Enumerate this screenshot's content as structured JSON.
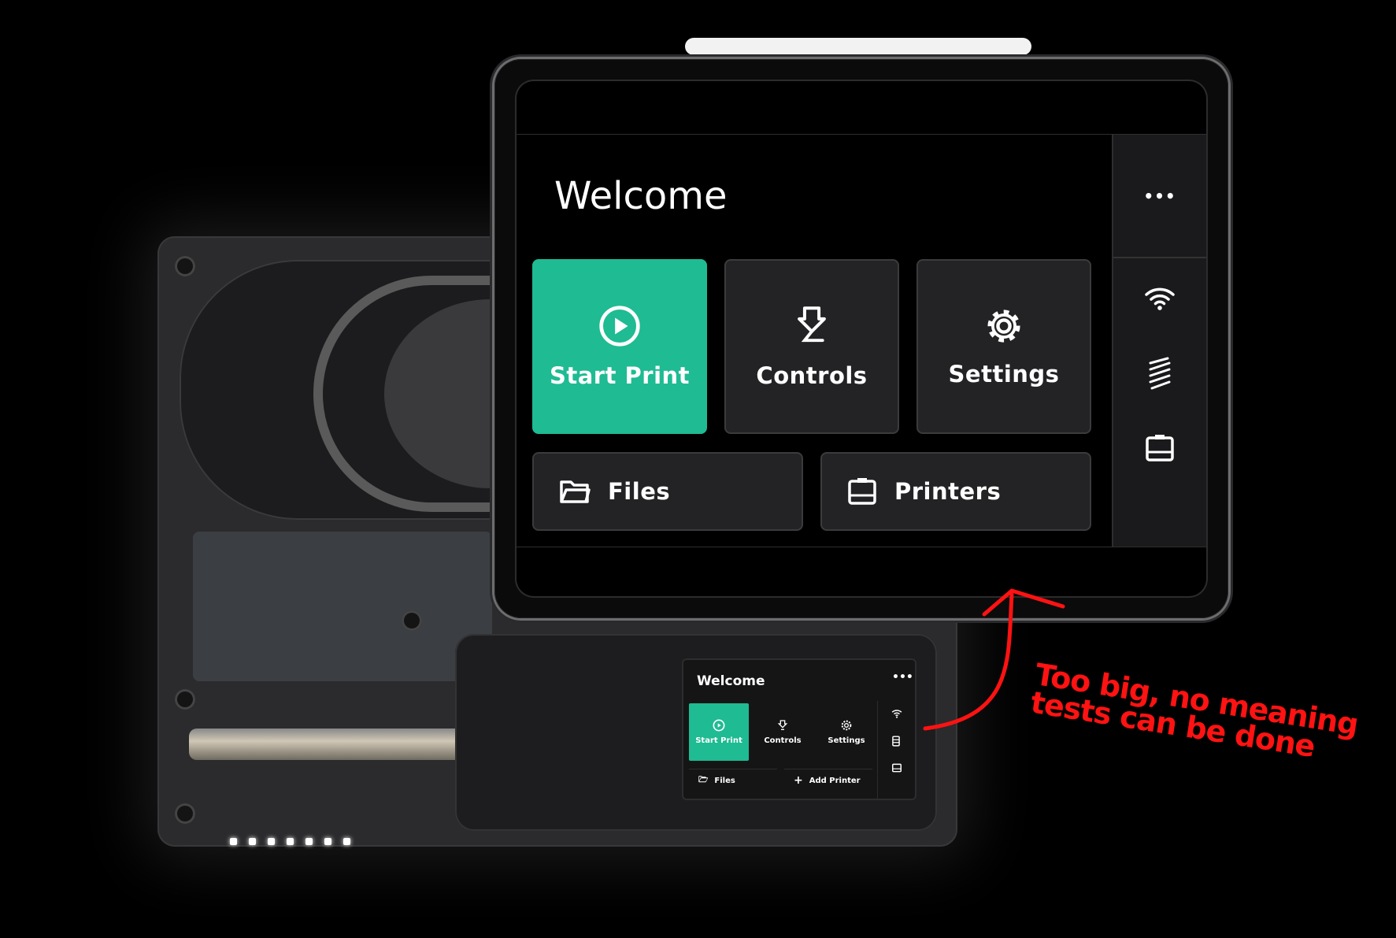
{
  "main_screen": {
    "title": "Welcome",
    "tiles": [
      {
        "label": "Start Print",
        "icon": "play-circle-icon",
        "primary": true
      },
      {
        "label": "Controls",
        "icon": "extruder-icon"
      },
      {
        "label": "Settings",
        "icon": "gear-icon"
      }
    ],
    "wide_tiles": [
      {
        "label": "Files",
        "icon": "folder-icon"
      },
      {
        "label": "Printers",
        "icon": "printer-icon"
      }
    ],
    "rail": {
      "more": "•••",
      "icons": [
        "wifi-icon",
        "filament-icon",
        "printer-icon"
      ]
    },
    "accent_color": "#1fbb93"
  },
  "mini_screen": {
    "title": "Welcome",
    "more": "•••",
    "tiles": [
      {
        "label": "Start Print",
        "icon": "play-circle-icon",
        "primary": true
      },
      {
        "label": "Controls",
        "icon": "extruder-icon"
      },
      {
        "label": "Settings",
        "icon": "gear-icon"
      }
    ],
    "files_label": "Files",
    "add_printer_label": "Add Printer"
  },
  "annotation": {
    "line1": "Too big, no meaning",
    "line2": "tests can be done",
    "color": "#ff1212"
  }
}
